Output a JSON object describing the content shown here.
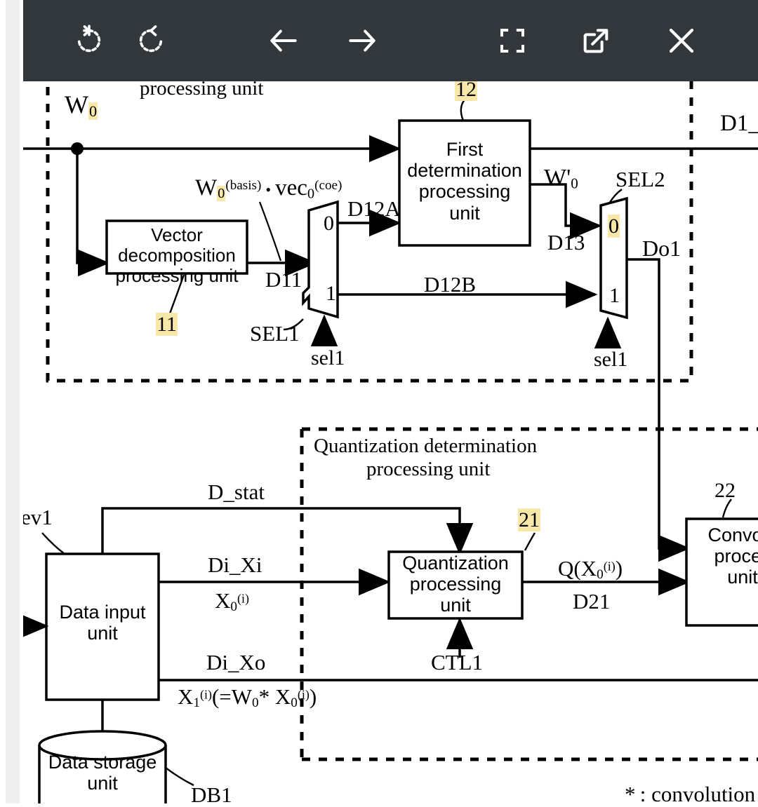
{
  "toolbar": {
    "buttons": [
      {
        "name": "rotate-left-icon",
        "label": "Rotate left"
      },
      {
        "name": "rotate-right-icon",
        "label": "Rotate right"
      },
      {
        "name": "previous-arrow-icon",
        "label": "Previous"
      },
      {
        "name": "next-arrow-icon",
        "label": "Next"
      },
      {
        "name": "fullscreen-icon",
        "label": "Fullscreen"
      },
      {
        "name": "open-external-icon",
        "label": "Open in new window"
      },
      {
        "name": "close-icon",
        "label": "Close"
      }
    ]
  },
  "figure": {
    "top_group": {
      "title_clipped": "processing unit",
      "blocks": [
        {
          "id": "vector-decomposition",
          "lines": [
            "Vector",
            "decomposition",
            "processing unit"
          ],
          "ref": "11"
        },
        {
          "id": "first-determination",
          "lines": [
            "First",
            "determination",
            "processing",
            "unit"
          ],
          "ref": "12"
        }
      ],
      "muxes": [
        {
          "id": "sel1-mux",
          "name": "SEL1",
          "input_top": "0",
          "input_bottom": "1",
          "control": "sel1"
        },
        {
          "id": "sel2-mux",
          "name": "SEL2",
          "input_top": "0",
          "input_bottom": "1",
          "control": "sel1"
        }
      ],
      "signals": {
        "w0": "W",
        "w0_sub": "0",
        "w_basis_expr": "W",
        "w_basis_sub": "0",
        "w_basis_sup": "(basis)",
        "vec_dot": "•",
        "vec": "vec",
        "vec_sub": "0",
        "vec_sup": "(coe)",
        "d11": "D11",
        "d12a": "D12A",
        "d12b": "D12B",
        "d13": "D13",
        "w0_prime": "W'",
        "w0_prime_sub": "0",
        "do1": "Do1",
        "d1_clipped": "D1_"
      }
    },
    "quantization_group": {
      "title_line1": "Quantization determination",
      "title_line2": "processing unit",
      "block": {
        "id": "quantization-processing",
        "lines": [
          "Quantization",
          "processing",
          "unit"
        ],
        "ref": "21"
      },
      "signals": {
        "ctl1": "CTL1",
        "q_out": "Q(X",
        "q_out_sub": "0",
        "q_out_sup": "(i)",
        "q_out_close": ")",
        "d21": "D21"
      }
    },
    "data_section": {
      "input_block": {
        "id": "data-input",
        "lines": [
          "Data input",
          "unit"
        ],
        "ref": "ev1"
      },
      "storage_block": {
        "id": "data-storage",
        "lines": [
          "Data storage",
          "unit"
        ],
        "ref": "DB1"
      },
      "signals": {
        "d_stat": "D_stat",
        "di_xi": "Di_Xi",
        "x0": "X",
        "x0_sub": "0",
        "x0_sup": "(i)",
        "di_xo": "Di_Xo",
        "x1_expr_a": "X",
        "x1_sub": "1",
        "x1_sup": "(i)",
        "x1_expr_b": "(=W",
        "x1_w_sub": "0",
        "x1_expr_c": "* X",
        "x1_x_sub": "0",
        "x1_x_sup": "(i)",
        "x1_expr_d": ")"
      }
    },
    "conv_block": {
      "id": "convolution",
      "lines": [
        "Convolu",
        "proces",
        "unit"
      ],
      "ref": "22",
      "clipped": true
    },
    "footnote": "* : convolution"
  },
  "colors": {
    "toolbar_bg": "#32373b",
    "toolbar_fg": "#ffffff",
    "page_bg": "#ffffff",
    "ink": "#000000",
    "highlight": "#f7e7a8",
    "scroll_track": "#efefef"
  }
}
